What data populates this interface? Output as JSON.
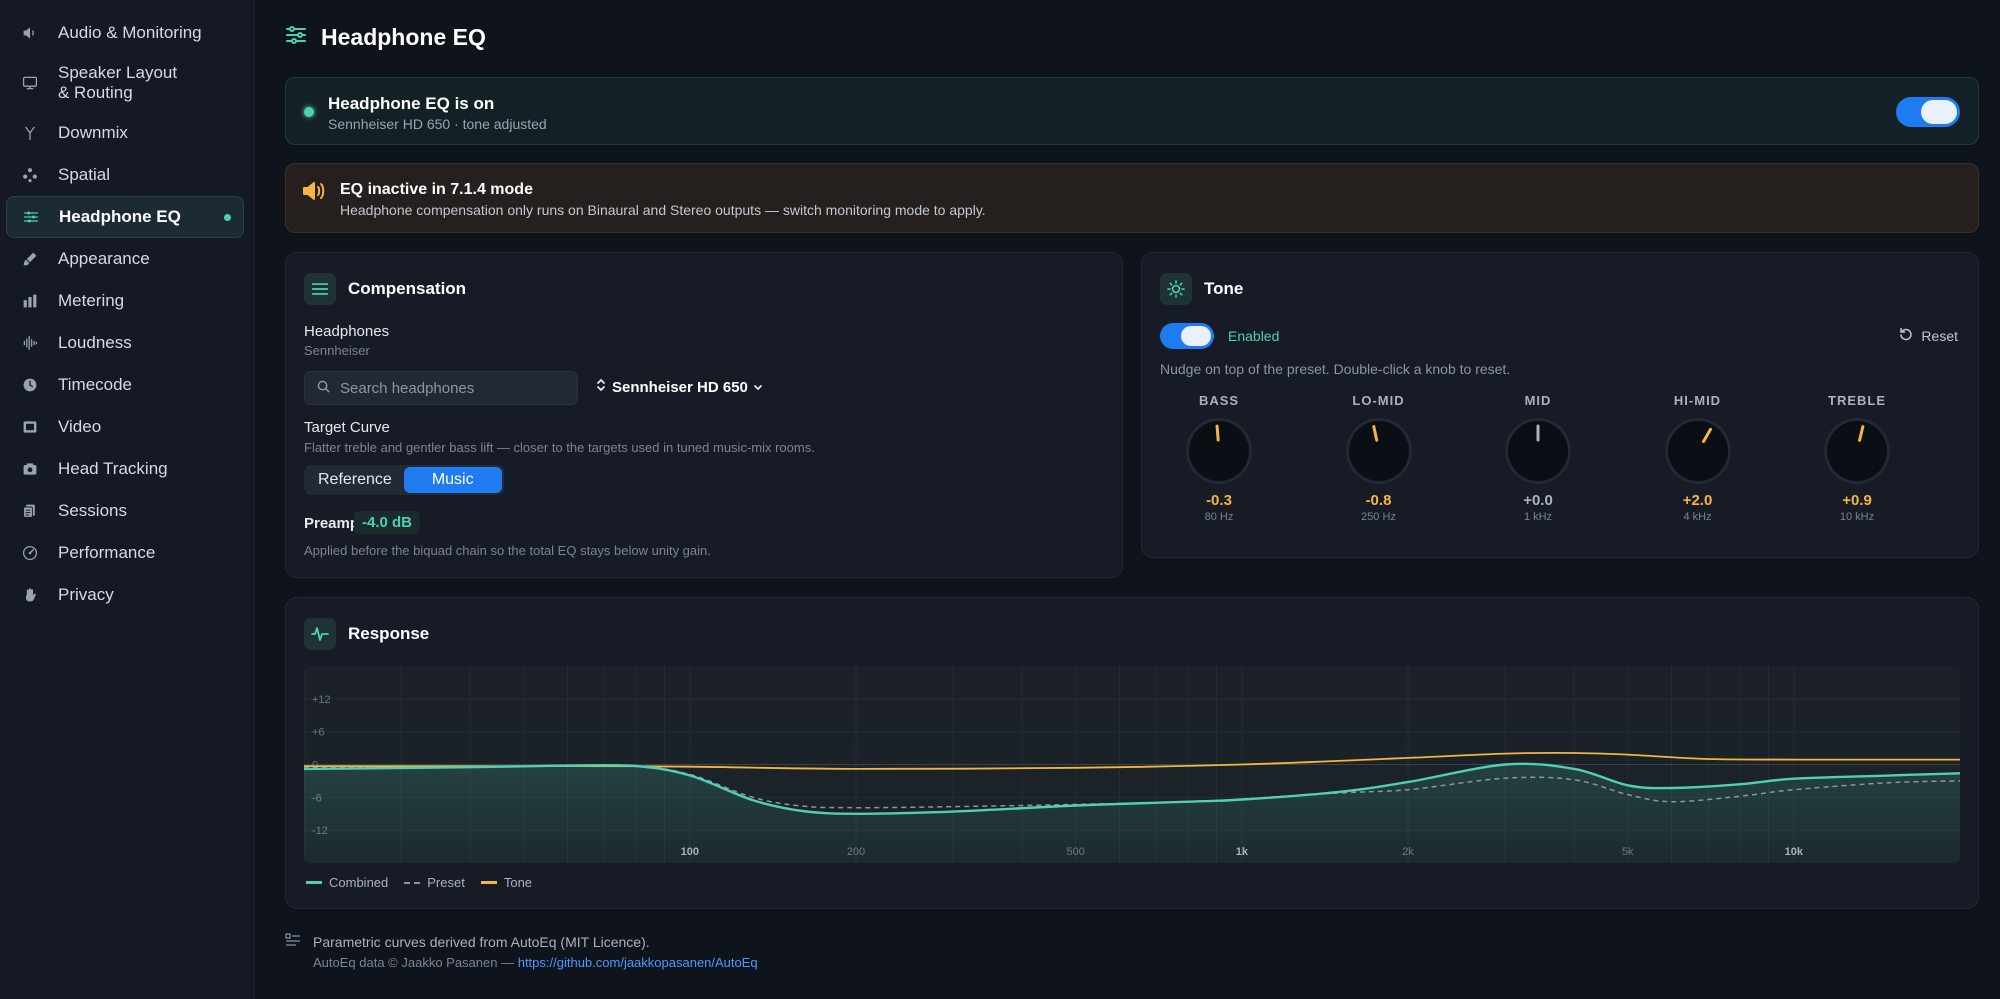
{
  "sidebar": {
    "items": [
      {
        "label": "Audio & Monitoring",
        "icon": "speaker-icon"
      },
      {
        "label": "Speaker Layout\n& Routing",
        "icon": "monitor-icon"
      },
      {
        "label": "Downmix",
        "icon": "downmix-icon"
      },
      {
        "label": "Spatial",
        "icon": "spatial-icon"
      },
      {
        "label": "Headphone EQ",
        "icon": "sliders-icon",
        "active": true
      },
      {
        "label": "Appearance",
        "icon": "brush-icon"
      },
      {
        "label": "Metering",
        "icon": "bars-icon"
      },
      {
        "label": "Loudness",
        "icon": "waveform-icon"
      },
      {
        "label": "Timecode",
        "icon": "clock-icon"
      },
      {
        "label": "Video",
        "icon": "film-icon"
      },
      {
        "label": "Head Tracking",
        "icon": "camera-icon"
      },
      {
        "label": "Sessions",
        "icon": "documents-icon"
      },
      {
        "label": "Performance",
        "icon": "gauge-icon"
      },
      {
        "label": "Privacy",
        "icon": "hand-icon"
      }
    ]
  },
  "header": {
    "title": "Headphone EQ"
  },
  "status_banner": {
    "title": "Headphone EQ is on",
    "subtitle": "Sennheiser HD 650 · tone adjusted",
    "enabled": true
  },
  "warning_banner": {
    "title": "EQ inactive in 7.1.4 mode",
    "message": "Headphone compensation only runs on Binaural and Stereo outputs — switch monitoring mode to apply."
  },
  "compensation": {
    "title": "Compensation",
    "headphones_label": "Headphones",
    "brand": "Sennheiser",
    "search_placeholder": "Search headphones",
    "selected_model": "Sennheiser HD 650",
    "target_label": "Target Curve",
    "target_desc": "Flatter treble and gentler bass lift — closer to the targets used in tuned music-mix rooms.",
    "target_options": [
      "Reference",
      "Music"
    ],
    "target_selected": "Music",
    "preamp_label": "Preamp",
    "preamp_value": "-4.0 dB",
    "preamp_desc": "Applied before the biquad chain so the total EQ stays below unity gain."
  },
  "tone": {
    "title": "Tone",
    "enabled_label": "Enabled",
    "reset_label": "Reset",
    "hint": "Nudge on top of the preset. Double-click a knob to reset.",
    "bands": [
      {
        "name": "BASS",
        "value": "-0.3",
        "gain": -0.3,
        "freq": "80 Hz"
      },
      {
        "name": "LO-MID",
        "value": "-0.8",
        "gain": -0.8,
        "freq": "250 Hz"
      },
      {
        "name": "MID",
        "value": "+0.0",
        "gain": 0.0,
        "freq": "1 kHz"
      },
      {
        "name": "HI-MID",
        "value": "+2.0",
        "gain": 2.0,
        "freq": "4 kHz"
      },
      {
        "name": "TREBLE",
        "value": "+0.9",
        "gain": 0.9,
        "freq": "10 kHz"
      }
    ],
    "active_color": "#f4b541",
    "neutral_color": "#aab2bf"
  },
  "response": {
    "title": "Response",
    "y_ticks": [
      "+12",
      "+6",
      "0",
      "-6",
      "-12"
    ],
    "x_ticks": [
      {
        "label": "100",
        "f": 100,
        "bold": true
      },
      {
        "label": "200",
        "f": 200,
        "bold": false
      },
      {
        "label": "500",
        "f": 500,
        "bold": false
      },
      {
        "label": "1k",
        "f": 1000,
        "bold": true
      },
      {
        "label": "2k",
        "f": 2000,
        "bold": false
      },
      {
        "label": "5k",
        "f": 5000,
        "bold": false
      },
      {
        "label": "10k",
        "f": 10000,
        "bold": true
      }
    ],
    "legend": [
      {
        "label": "Combined",
        "color": "#4fd1b0",
        "style": "solid"
      },
      {
        "label": "Preset",
        "color": "#8c95a5",
        "style": "dashed"
      },
      {
        "label": "Tone",
        "color": "#f4b541",
        "style": "solid"
      }
    ]
  },
  "chart_data": {
    "type": "line",
    "xscale": "log",
    "xlim": [
      20,
      20000
    ],
    "ylim": [
      -18,
      18
    ],
    "grid": true,
    "legend": "bottom-left",
    "series": [
      {
        "name": "Combined",
        "color": "#4fd1b0",
        "x": [
          20,
          40,
          60,
          80,
          100,
          130,
          160,
          200,
          300,
          500,
          800,
          1000,
          1500,
          2000,
          3000,
          4000,
          5000,
          6000,
          8000,
          10000,
          15000,
          20000
        ],
        "y": [
          -0.8,
          -0.5,
          -0.2,
          -0.3,
          -2.0,
          -6.5,
          -8.5,
          -9.0,
          -8.6,
          -7.5,
          -6.8,
          -6.4,
          -5.0,
          -3.2,
          0.0,
          -0.8,
          -3.8,
          -4.3,
          -3.6,
          -2.6,
          -2.0,
          -1.6
        ]
      },
      {
        "name": "Preset",
        "color": "#8c95a5",
        "x": [
          20,
          40,
          60,
          80,
          100,
          130,
          160,
          200,
          300,
          500,
          800,
          1000,
          1500,
          2000,
          3000,
          4000,
          5000,
          6000,
          8000,
          10000,
          15000,
          20000
        ],
        "y": [
          -0.6,
          -0.4,
          -0.3,
          -0.3,
          -1.8,
          -6.0,
          -7.6,
          -7.9,
          -7.7,
          -7.3,
          -6.8,
          -6.3,
          -5.2,
          -4.6,
          -2.5,
          -2.8,
          -5.5,
          -6.8,
          -5.8,
          -4.6,
          -3.3,
          -3.0
        ]
      },
      {
        "name": "Tone",
        "color": "#f4b541",
        "x": [
          20,
          60,
          100,
          200,
          500,
          1000,
          2000,
          3000,
          4000,
          5000,
          7000,
          10000,
          15000,
          20000
        ],
        "y": [
          -0.3,
          -0.3,
          -0.4,
          -0.8,
          -0.6,
          0.0,
          1.2,
          2.0,
          2.1,
          1.8,
          1.0,
          0.9,
          0.9,
          0.9
        ]
      }
    ]
  },
  "footer": {
    "line1": "Parametric curves derived from AutoEq (MIT Licence).",
    "line2": "AutoEq data © Jaakko Pasanen — ",
    "link": "https://github.com/jaakkopasanen/AutoEq"
  }
}
